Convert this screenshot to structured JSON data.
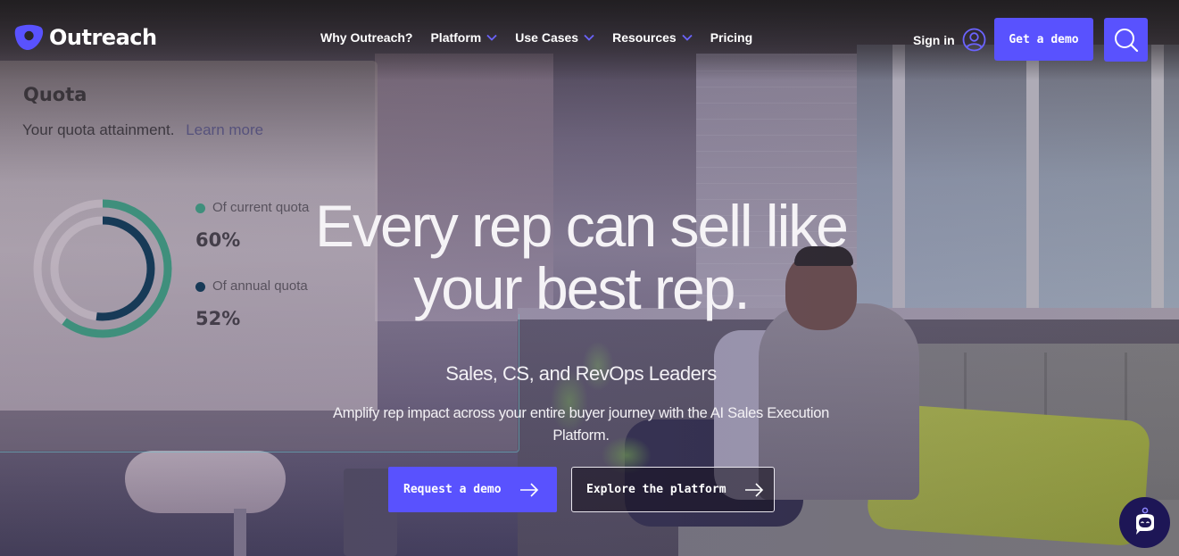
{
  "nav": {
    "logo_text": "Outreach",
    "links": [
      {
        "label": "Why Outreach?",
        "has_dropdown": false
      },
      {
        "label": "Platform",
        "has_dropdown": true
      },
      {
        "label": "Use Cases",
        "has_dropdown": true
      },
      {
        "label": "Resources",
        "has_dropdown": true
      },
      {
        "label": "Pricing",
        "has_dropdown": false
      }
    ],
    "sign_in_label": "Sign in",
    "get_demo_label": "Get a demo",
    "search_icon": "search-icon",
    "user_icon": "user-circle-icon"
  },
  "quota_card": {
    "title": "Quota",
    "subtitle": "Your quota attainment.",
    "learn_more": "Learn more",
    "metrics": [
      {
        "label": "Of current quota",
        "value": "60%",
        "fraction": 0.6,
        "color": "#3f8f7c"
      },
      {
        "label": "Of annual quota",
        "value": "52%",
        "fraction": 0.52,
        "color": "#173a57"
      }
    ]
  },
  "hero": {
    "title_line1": "Every rep can sell like",
    "title_line2": "your best rep.",
    "subtitle": "Sales, CS, and RevOps Leaders",
    "description": "Amplify rep impact across your entire buyer journey with the AI Sales Execution Platform.",
    "primary_cta": "Request a demo",
    "secondary_cta": "Explore the platform"
  },
  "chat_widget": {
    "icon": "chatbot-icon"
  },
  "colors": {
    "brand": "#5952fe",
    "chat_bg": "#1d1656",
    "teal": "#3f8f7c",
    "navy": "#173a57"
  }
}
